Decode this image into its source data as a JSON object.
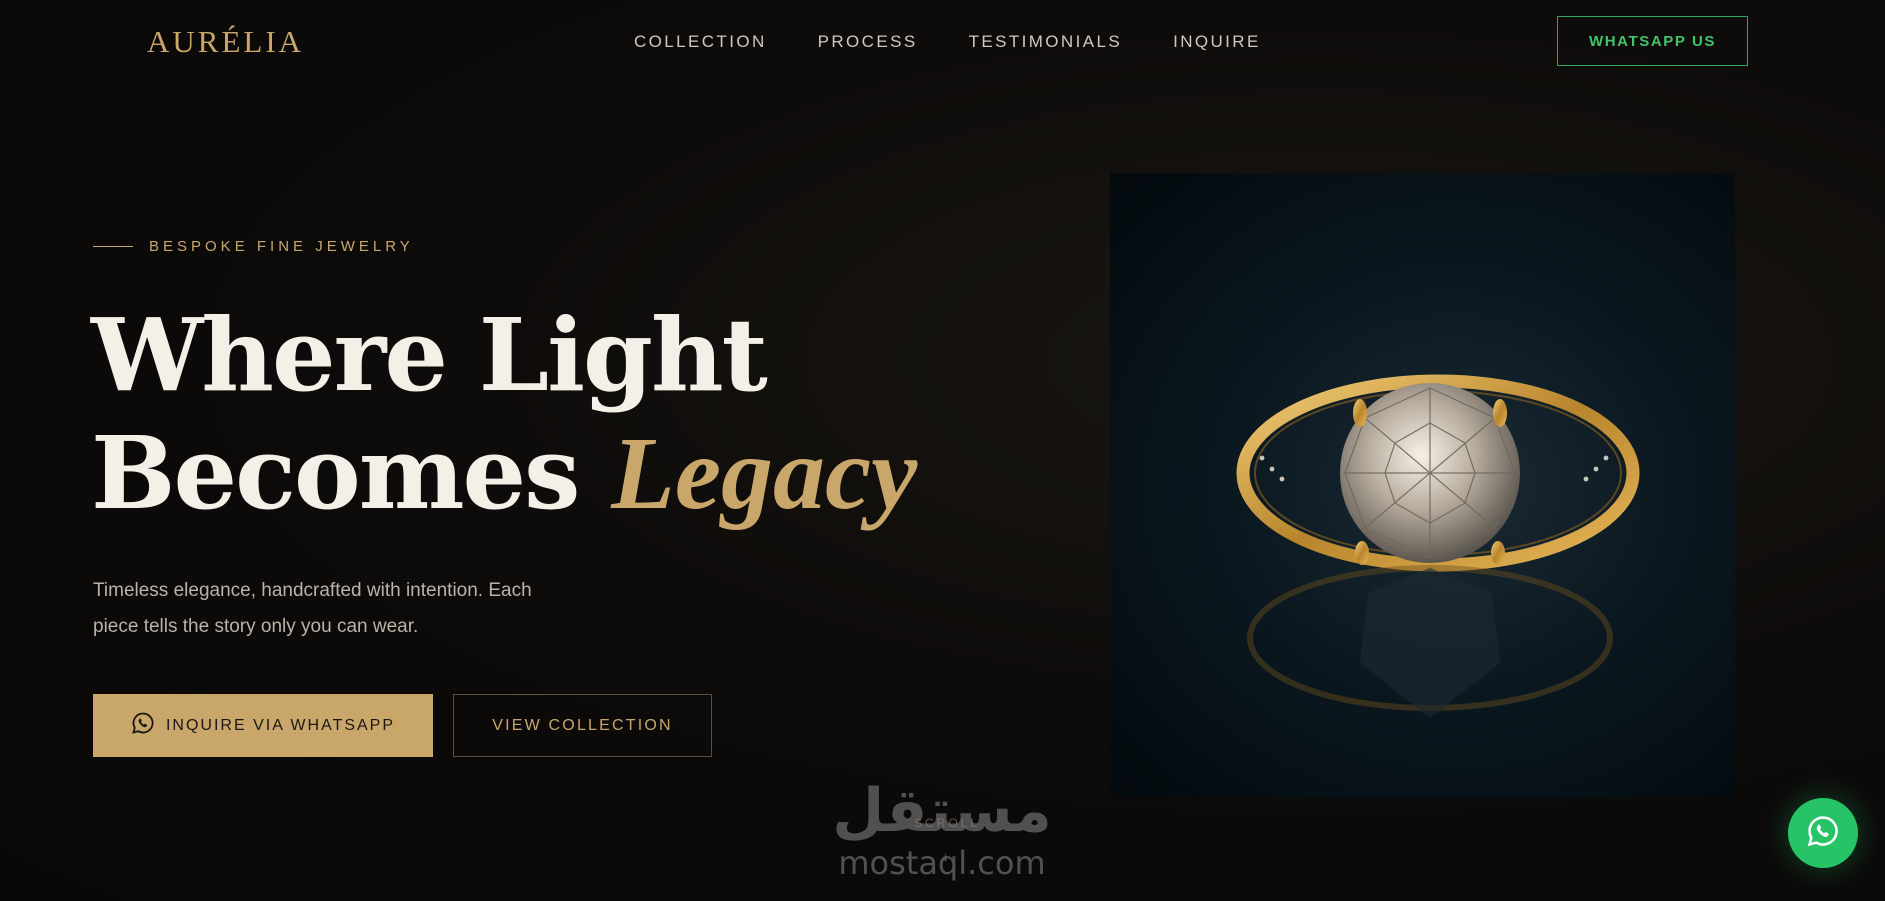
{
  "nav": {
    "logo": "AURÉLIA",
    "links": [
      "COLLECTION",
      "PROCESS",
      "TESTIMONIALS",
      "INQUIRE"
    ],
    "whatsapp_label": "WHATSAPP US"
  },
  "hero": {
    "eyebrow": "BESPOKE FINE JEWELRY",
    "headline_line1": "Where Light",
    "headline_line2": "Becomes",
    "headline_accent": "Legacy",
    "description": "Timeless elegance, handcrafted with intention. Each piece tells the story only you can wear.",
    "primary_button": "INQUIRE VIA WHATSAPP",
    "secondary_button": "VIEW COLLECTION",
    "scroll_label": "SCROLL",
    "scroll_arrow": "↓"
  },
  "watermark": {
    "arabic": "مستقل",
    "latin": "mostaql.com"
  },
  "icons": {
    "primary_button_icon": "whatsapp-icon",
    "floating_button_icon": "whatsapp-icon"
  },
  "colors": {
    "gold": "#c9a76a",
    "whatsapp_green": "#26c466",
    "background": "#0e0c0a"
  }
}
